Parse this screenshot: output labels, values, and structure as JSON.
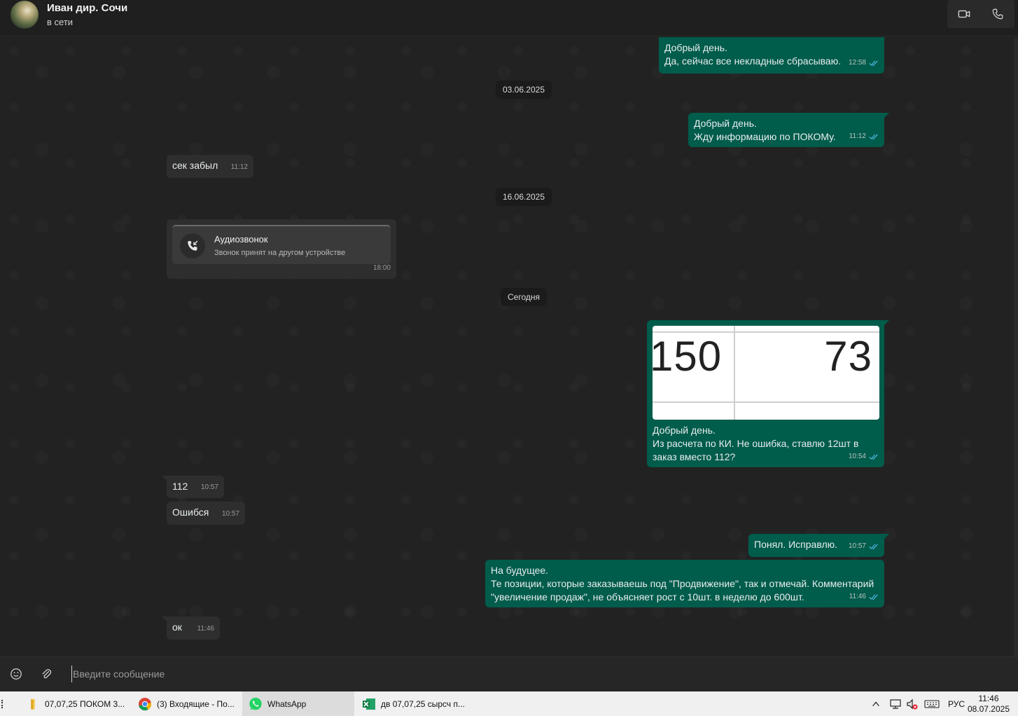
{
  "header": {
    "name": "Иван дир. Сочи",
    "status": "в сети"
  },
  "dates": {
    "d1": "03.06.2025",
    "d2": "16.06.2025",
    "d3": "Сегодня"
  },
  "messages": {
    "m1": {
      "text": "Добрый день.\nДа, сейчас все некладные сбрасываю.",
      "time": "12:58"
    },
    "m2": {
      "text": "Добрый день.\nЖду информацию по ПОКОМу.",
      "time": "11:12"
    },
    "m3": {
      "text": "сек забыл",
      "time": "11:12"
    },
    "call": {
      "title": "Аудиозвонок",
      "subtitle": "Звонок принят на другом устройстве",
      "time": "18:00"
    },
    "m5": {
      "text": "Добрый день.\nИз расчета по КИ. Не ошибка, ставлю 12шт в\nзаказ вместо 112?",
      "time": "10:54",
      "image_left": "150",
      "image_right": "73"
    },
    "m6": {
      "text": "112",
      "time": "10:57"
    },
    "m7": {
      "text": "Ошибся",
      "time": "10:57"
    },
    "m8": {
      "text": "Понял. Исправлю.",
      "time": "10:57"
    },
    "m9": {
      "text": "На будущее.\nТе позиции, которые заказываешь под \"Продвижение\", так и отмечай. Комментарий\n\"увеличение продаж\", не объясняет рост с 10шт. в неделю до 600шт.",
      "time": "11:46"
    },
    "m10": {
      "text": "ок",
      "time": "11:46"
    }
  },
  "composer": {
    "placeholder": "Введите сообщение"
  },
  "taskbar": {
    "items": [
      {
        "label": "07,07,25 ПОКОМ 3...",
        "icon": "folder-icon"
      },
      {
        "label": "(3) Входящие - По...",
        "icon": "chrome-icon"
      },
      {
        "label": "WhatsApp",
        "icon": "whatsapp-icon"
      },
      {
        "label": "дв 07,07,25 сырсч п...",
        "icon": "excel-icon"
      }
    ],
    "lang": "РУС",
    "time": "11:46",
    "date": "08.07.2025"
  },
  "colors": {
    "outgoing": "#005c4b",
    "incoming": "#2e2e2e",
    "read_ticks": "#53bdeb"
  }
}
